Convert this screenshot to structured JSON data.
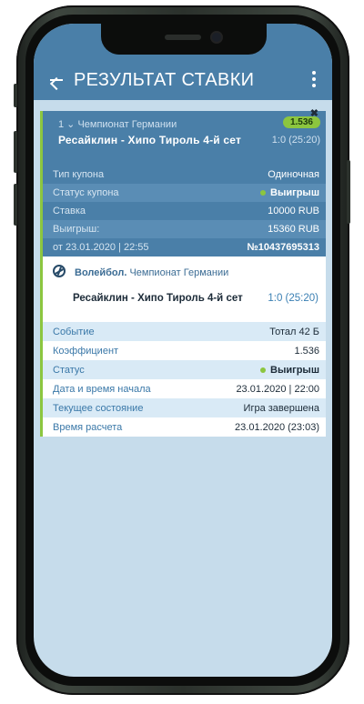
{
  "header": {
    "title": "РЕЗУЛЬТАТ СТАВКИ"
  },
  "coupon": {
    "league_line": "1 ⌄ Чемпионат Германии",
    "match": "Ресайклин - Хипо Тироль 4-й сет",
    "odds": "1.536",
    "score": "1:0 (25:20)",
    "close_icon": "close-icon"
  },
  "summary": [
    {
      "label": "Тип купона",
      "value": "Одиночная"
    },
    {
      "label": "Статус купона",
      "value": "Выигрыш"
    },
    {
      "label": "Ставка",
      "value": "10000 RUB"
    },
    {
      "label": "Выигрыш:",
      "value": "15360 RUB"
    },
    {
      "label": "от 23.01.2020 | 22:55",
      "value": "№10437695313"
    }
  ],
  "event": {
    "sport": "Волейбол.",
    "league": "Чемпионат Германии",
    "teams": "Ресайклин - Хипо Тироль 4-й сет",
    "score": "1:0 (25:20)"
  },
  "details": [
    {
      "label": "Событие",
      "value": "Тотал 42 Б"
    },
    {
      "label": "Коэффициент",
      "value": "1.536"
    },
    {
      "label": "Статус",
      "value": "Выигрыш"
    },
    {
      "label": "Дата и время начала",
      "value": "23.01.2020 | 22:00"
    },
    {
      "label": "Текущее состояние",
      "value": "Игра завершена"
    },
    {
      "label": "Время расчета",
      "value": "23.01.2020 (23:03)"
    }
  ],
  "colors": {
    "primary": "#4a7fa8",
    "accent": "#8cc63f",
    "background": "#c6dceb"
  }
}
